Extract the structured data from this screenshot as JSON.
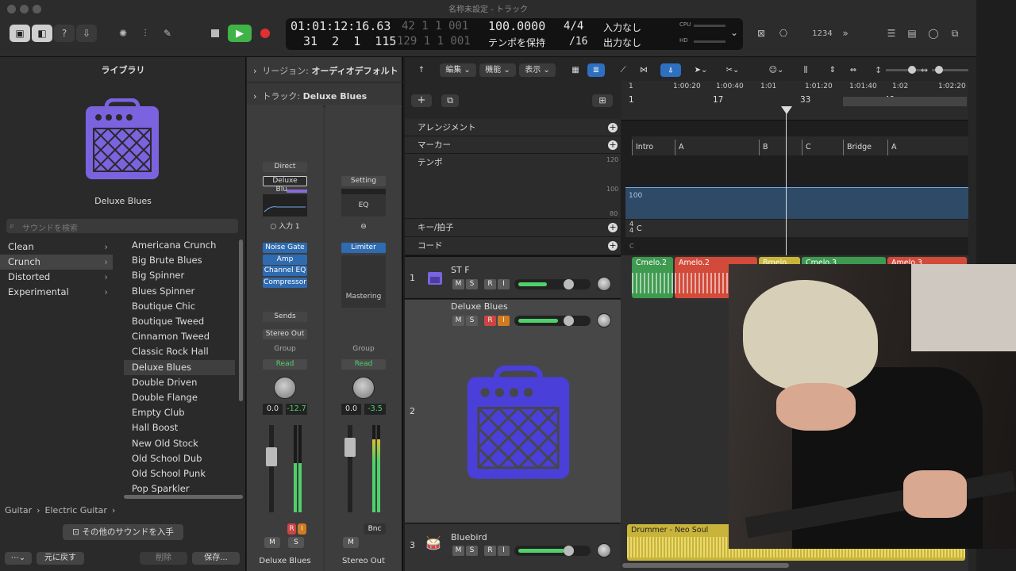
{
  "window": {
    "title": "名称未設定 - トラック"
  },
  "transport": {
    "position_time": "01:01:12:16.63",
    "position_bars": "31  2  1  115",
    "dim_time": "42  1  1  001",
    "dim_bars": "129  1  1  001",
    "tempo": "100.0000",
    "tempo_mode": "テンポを保持",
    "signature": "4/4",
    "division": "/16",
    "input": "入力なし",
    "output": "出力なし",
    "cpu_label": "CPU",
    "hd_label": "HD"
  },
  "toolbar": {
    "count_in": "1234"
  },
  "library": {
    "title": "ライブラリ",
    "patch_name": "Deluxe Blues",
    "search_placeholder": "サウンドを検索",
    "categories": [
      {
        "label": "Clean"
      },
      {
        "label": "Crunch"
      },
      {
        "label": "Distorted"
      },
      {
        "label": "Experimental"
      }
    ],
    "sounds": [
      "Americana Crunch",
      "Big Brute Blues",
      "Big Spinner",
      "Blues Spinner",
      "Boutique Chic",
      "Boutique Tweed",
      "Cinnamon Tweed",
      "Classic Rock Hall",
      "Deluxe Blues",
      "Double Driven",
      "Double Flange",
      "Empty Club",
      "Hall Boost",
      "New Old Stock",
      "Old School Dub",
      "Old School Punk",
      "Pop Sparkler"
    ],
    "breadcrumb_1": "Guitar",
    "breadcrumb_2": "Electric Guitar",
    "get_more": "その他のサウンドを入手",
    "revert": "元に戻す",
    "delete": "削除",
    "save": "保存..."
  },
  "inspector": {
    "region_label": "リージョン:",
    "region_value": "オーディオデフォルト",
    "track_label": "トラック:",
    "track_value": "Deluxe Blues",
    "strip1": {
      "eq_label": "Direct",
      "setting": "Deluxe Blu...",
      "input": "入力 1",
      "plugins": [
        "Noise Gate",
        "Amp",
        "Channel EQ",
        "Compressor"
      ],
      "sends": "Sends",
      "output": "Stereo Out",
      "group": "Group",
      "automation": "Read",
      "pan_value": "0.0",
      "level": "-12.7",
      "name": "Deluxe Blues",
      "m": "M",
      "s": "S",
      "r": "R",
      "i": "I"
    },
    "strip2": {
      "setting": "Setting",
      "eq": "EQ",
      "plugins": [
        "Limiter"
      ],
      "mastering": "Mastering",
      "group": "Group",
      "automation": "Read",
      "pan_value": "0.0",
      "level": "-3.5",
      "bnc": "Bnc",
      "name": "Stereo Out",
      "m": "M"
    }
  },
  "tracks_area": {
    "menu_edit": "編集",
    "menu_function": "機能",
    "menu_view": "表示",
    "global": [
      {
        "label": "アレンジメント"
      },
      {
        "label": "マーカー"
      },
      {
        "label": "テンポ"
      },
      {
        "label": "キー/拍子"
      },
      {
        "label": "コード"
      }
    ],
    "tempo_ticks": [
      "120",
      "100",
      "80"
    ],
    "tempo_value": "100",
    "key_sig": "4\n4",
    "key_name": "C",
    "chord_mark": "C",
    "time_ruler": [
      "1",
      "1:00:20",
      "1:00:40",
      "1:01",
      "1:01:20",
      "1:01:40",
      "1:02",
      "1:02:20"
    ],
    "bar_ruler": [
      "1",
      "17",
      "33",
      "49"
    ],
    "markers": [
      "Intro",
      "A",
      "B",
      "C",
      "Bridge",
      "A"
    ],
    "tracks": [
      {
        "num": "1",
        "name": "ST F"
      },
      {
        "num": "",
        "name": "Deluxe Blues"
      },
      {
        "num": "2",
        "name": ""
      },
      {
        "num": "3",
        "name": "Bluebird"
      }
    ],
    "regions_track1": [
      "Cmelo.2",
      "Amelo.2",
      "Bmelo.",
      "Cmelo.3",
      "Amelo.3"
    ],
    "region_track3": "Drummer - Neo Soul",
    "btn_m": "M",
    "btn_s": "S",
    "btn_r": "R",
    "btn_i": "I"
  },
  "colors": {
    "green": "#3d9a4e",
    "red": "#d24a3a",
    "yellow": "#c8b43a",
    "blue": "#2d6fc0",
    "amp_purple": "#7b63e0",
    "amp_blue": "#4a3fd8"
  }
}
